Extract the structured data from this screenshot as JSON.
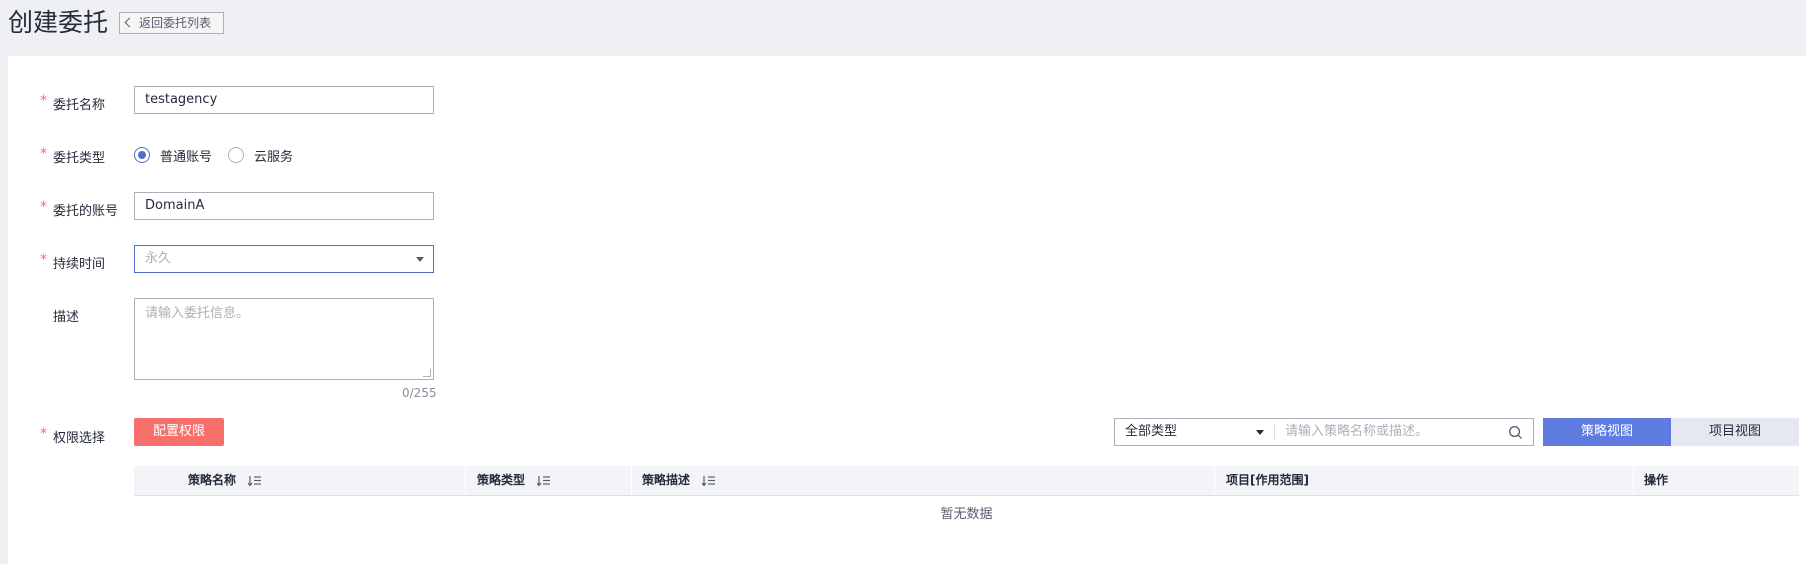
{
  "header": {
    "title": "创建委托",
    "back_label": "返回委托列表"
  },
  "form": {
    "name": {
      "label": "委托名称",
      "value": "testagency"
    },
    "type": {
      "label": "委托类型",
      "options": [
        {
          "label": "普通账号",
          "selected": true
        },
        {
          "label": "云服务",
          "selected": false
        }
      ]
    },
    "account": {
      "label": "委托的账号",
      "value": "DomainA"
    },
    "duration": {
      "label": "持续时间",
      "placeholder": "永久"
    },
    "description": {
      "label": "描述",
      "placeholder": "请输入委托信息。",
      "counter": "0/255"
    },
    "permission": {
      "label": "权限选择",
      "config_button": "配置权限"
    }
  },
  "policy_filter": {
    "type_value": "全部类型",
    "search_placeholder": "请输入策略名称或描述。"
  },
  "view_toggle": {
    "policy_view": "策略视图",
    "project_view": "项目视图"
  },
  "table": {
    "columns": [
      "策略名称",
      "策略类型",
      "策略描述",
      "项目[作用范围]",
      "操作"
    ],
    "empty_text": "暂无数据"
  },
  "colors": {
    "required_star": "#f66f6a",
    "primary": "#5e7ce0",
    "danger_button": "#f66f6a"
  }
}
